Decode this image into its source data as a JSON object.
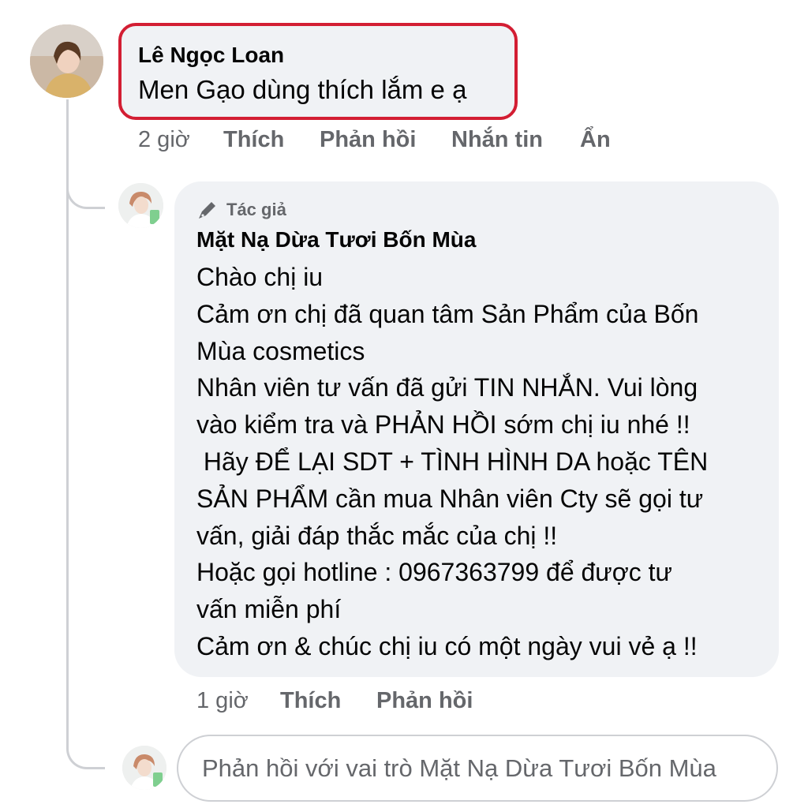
{
  "comment": {
    "author": "Lê Ngọc Loan",
    "text": "Men Gạo dùng thích lắm e ạ",
    "time": "2 giờ",
    "actions": {
      "like": "Thích",
      "reply": "Phản hồi",
      "message": "Nhắn tin",
      "hide": "Ẩn"
    }
  },
  "reply": {
    "badge": "Tác giả",
    "author": "Mặt Nạ Dừa Tươi Bốn Mùa",
    "lines": [
      "Chào chị iu",
      "Cảm ơn chị đã quan tâm Sản Phẩm của Bốn",
      "Mùa cosmetics",
      "Nhân viên tư vấn đã gửi TIN NHẮN. Vui lòng",
      "vào kiểm tra và PHẢN HỒI sớm chị iu nhé !!",
      " Hãy ĐỂ LẠI SDT + TÌNH HÌNH DA hoặc TÊN",
      "SẢN PHẨM cần mua Nhân viên Cty sẽ gọi tư",
      "vấn, giải đáp thắc mắc của chị !!",
      "Hoặc gọi hotline : 0967363799 để được tư",
      "vấn miễn phí",
      "Cảm ơn & chúc chị iu có một ngày vui vẻ ạ !!"
    ],
    "time": "1 giờ",
    "actions": {
      "like": "Thích",
      "reply": "Phản hồi"
    }
  },
  "composer": {
    "placeholder": "Phản hồi với vai trò Mặt Nạ Dừa Tươi Bốn Mùa"
  },
  "colors": {
    "highlight_border": "#d31e33",
    "bubble_bg": "#f0f2f5",
    "meta_text": "#65676b"
  }
}
